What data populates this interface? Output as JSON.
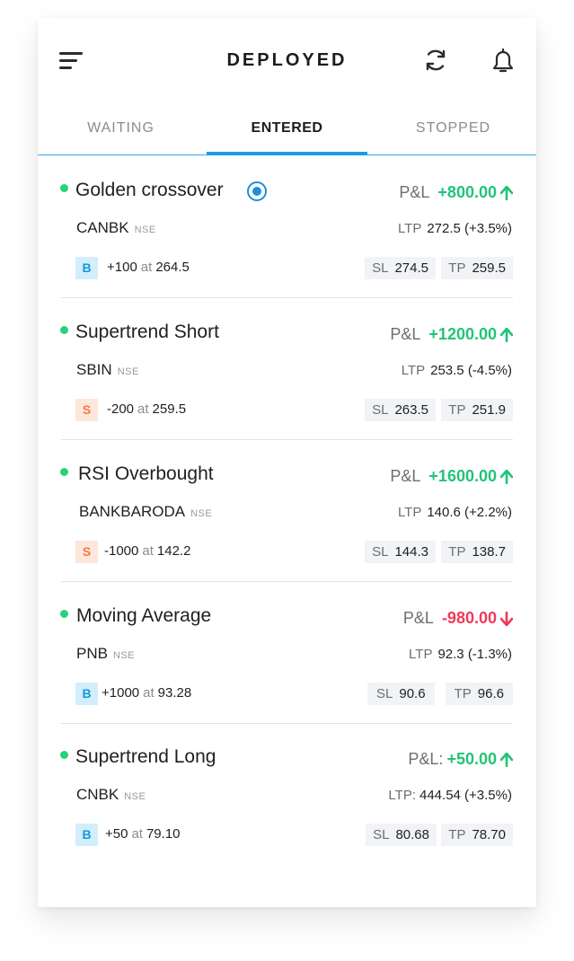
{
  "header": {
    "title": "DEPLOYED",
    "menu_icon": "hamburger-menu-icon",
    "refresh_icon": "refresh-icon",
    "bell_icon": "bell-icon"
  },
  "tabs": [
    {
      "label": "WAITING",
      "active": false
    },
    {
      "label": "ENTERED",
      "active": true
    },
    {
      "label": "STOPPED",
      "active": false
    }
  ],
  "colors": {
    "accent": "#1e9be6",
    "profit": "#22c477",
    "loss": "#ef3a59",
    "status_dot": "#27d27c",
    "buy_badge_bg": "#d3eefb",
    "sell_badge_bg": "#fde6dc"
  },
  "trades": [
    {
      "strategy": "Golden crossover",
      "selected": true,
      "pnl_label": "P&L",
      "pnl": "+800.00",
      "pnl_direction": "up",
      "symbol": "CANBK",
      "exchange": "NSE",
      "ltp_label": "LTP",
      "ltp": "272.5 (+3.5%)",
      "side": "B",
      "qty": "+100",
      "at": "at",
      "entry_price": "264.5",
      "sl_label": "SL",
      "sl": "274.5",
      "tp_label": "TP",
      "tp": "259.5"
    },
    {
      "strategy": "Supertrend Short",
      "selected": false,
      "pnl_label": "P&L",
      "pnl": "+1200.00",
      "pnl_direction": "up",
      "symbol": "SBIN",
      "exchange": "NSE",
      "ltp_label": "LTP",
      "ltp": "253.5 (-4.5%)",
      "side": "S",
      "qty": "-200",
      "at": "at",
      "entry_price": "259.5",
      "sl_label": "SL",
      "sl": "263.5",
      "tp_label": "TP",
      "tp": "251.9"
    },
    {
      "strategy": "RSI Overbought",
      "selected": false,
      "pnl_label": "P&L",
      "pnl": "+1600.00",
      "pnl_direction": "up",
      "symbol": "BANKBARODA",
      "exchange": "NSE",
      "ltp_label": "LTP",
      "ltp": "140.6 (+2.2%)",
      "side": "S",
      "qty": "-1000",
      "at": "at",
      "entry_price": "142.2",
      "sl_label": "SL",
      "sl": "144.3",
      "tp_label": "TP",
      "tp": "138.7"
    },
    {
      "strategy": "Moving Average",
      "selected": false,
      "pnl_label": "P&L",
      "pnl": "-980.00",
      "pnl_direction": "down",
      "symbol": "PNB",
      "exchange": "NSE",
      "ltp_label": "LTP",
      "ltp": "92.3 (-1.3%)",
      "side": "B",
      "qty": "+1000",
      "at": "at",
      "entry_price": "93.28",
      "sl_label": "SL",
      "sl": "90.6",
      "tp_label": "TP",
      "tp": "96.6"
    },
    {
      "strategy": "Supertrend Long",
      "selected": false,
      "pnl_label": "P&L:",
      "pnl": "+50.00",
      "pnl_direction": "up",
      "symbol": "CNBK",
      "exchange": "NSE",
      "ltp_label": "LTP:",
      "ltp": "444.54 (+3.5%)",
      "side": "B",
      "qty": "+50",
      "at": "at",
      "entry_price": "79.10",
      "sl_label": "SL",
      "sl": "80.68",
      "tp_label": "TP",
      "tp": "78.70"
    }
  ]
}
